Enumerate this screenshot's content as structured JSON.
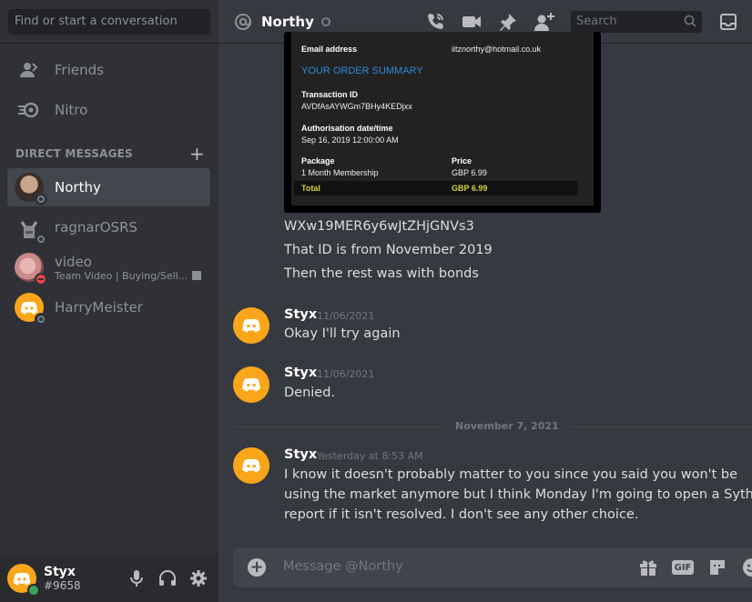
{
  "sidebar": {
    "search_placeholder": "Find or start a conversation",
    "nav": [
      {
        "label": "Friends",
        "icon": "friends-icon"
      },
      {
        "label": "Nitro",
        "icon": "nitro-icon"
      }
    ],
    "dm_header": "DIRECT MESSAGES",
    "dms": [
      {
        "name": "Northy",
        "status": "offline",
        "active": true
      },
      {
        "name": "ragnarOSRS",
        "status": "offline"
      },
      {
        "name": "video",
        "subtitle": "Team Video | Buying/Sell...",
        "status": "dnd"
      },
      {
        "name": "HarryMeister",
        "status": "offline"
      }
    ]
  },
  "user_panel": {
    "username": "Styx",
    "tag": "#9658",
    "status": "online"
  },
  "header": {
    "title": "Northy",
    "search_placeholder": "Search"
  },
  "receipt": {
    "email_label": "Email address",
    "email_value": "iitznorthy@hotmail.co.uk",
    "section_title": "YOUR ORDER SUMMARY",
    "transaction_label": "Transaction ID",
    "transaction_value": "AVDfAsAYWGm7BHy4KEDjxx",
    "auth_label": "Authorisation date/time",
    "auth_value": "Sep 16, 2019 12:00:00 AM",
    "package_label": "Package",
    "package_value": "1 Month Membership",
    "price_label": "Price",
    "price_value": "GBP 6.99",
    "total_label": "Total",
    "total_value": "GBP 6.99"
  },
  "messages": {
    "continued": [
      "WXw19MER6y6wJtZHjGNVs3",
      "That ID is from November 2019",
      "Then the rest was with bonds"
    ],
    "m1": {
      "author": "Styx",
      "time": "11/06/2021",
      "text": "Okay I'll try again"
    },
    "m2": {
      "author": "Styx",
      "time": "11/06/2021",
      "text": "Denied."
    },
    "divider": "November 7, 2021",
    "m3": {
      "author": "Styx",
      "time": "Yesterday at 8:53 AM",
      "lines": [
        "I know it doesn't probably matter to you since you said you won't be",
        "using the market anymore but I think Monday I'm going to open a Sythe",
        "report if it isn't resolved. I don't see any other choice."
      ]
    }
  },
  "composer": {
    "placeholder": "Message @Northy",
    "gif_label": "GIF"
  },
  "colors": {
    "accent_avatar": "#faa61a",
    "online": "#3ba55d",
    "dnd": "#ed4245",
    "link_blue": "#2e8ad8",
    "total_yellow": "#d5d43a"
  }
}
